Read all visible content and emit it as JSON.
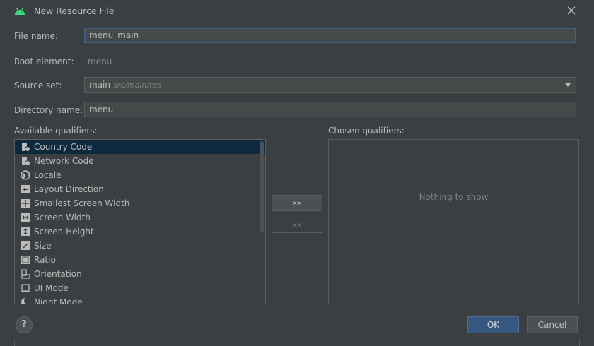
{
  "dialog": {
    "title": "New Resource File"
  },
  "form": {
    "file_name_label": "File name:",
    "file_name_value": "menu_main",
    "root_element_label": "Root element:",
    "root_element_value": "menu",
    "source_set_label": "Source set:",
    "source_set_value": "main",
    "source_set_path": "src/main/res",
    "directory_name_label": "Directory name:",
    "directory_name_value": "menu"
  },
  "qualifiers": {
    "available_label": "Available qualifiers:",
    "chosen_label": "Chosen qualifiers:",
    "items": [
      {
        "label": "Country Code",
        "icon": "country-code-icon"
      },
      {
        "label": "Network Code",
        "icon": "network-code-icon"
      },
      {
        "label": "Locale",
        "icon": "globe-icon"
      },
      {
        "label": "Layout Direction",
        "icon": "layout-direction-icon"
      },
      {
        "label": "Smallest Screen Width",
        "icon": "smallest-width-icon"
      },
      {
        "label": "Screen Width",
        "icon": "screen-width-icon"
      },
      {
        "label": "Screen Height",
        "icon": "screen-height-icon"
      },
      {
        "label": "Size",
        "icon": "size-icon"
      },
      {
        "label": "Ratio",
        "icon": "ratio-icon"
      },
      {
        "label": "Orientation",
        "icon": "orientation-icon"
      },
      {
        "label": "UI Mode",
        "icon": "ui-mode-icon"
      },
      {
        "label": "Night Mode",
        "icon": "night-mode-icon"
      }
    ],
    "add_label": ">>",
    "remove_label": "<<",
    "empty_text": "Nothing to show"
  },
  "buttons": {
    "help": "?",
    "ok": "OK",
    "cancel": "Cancel"
  },
  "colors": {
    "background": "#3c3f41",
    "selection": "#0d293e",
    "focus_border": "#3d6185",
    "ok_button": "#365880",
    "android_green": "#3ddc84"
  }
}
